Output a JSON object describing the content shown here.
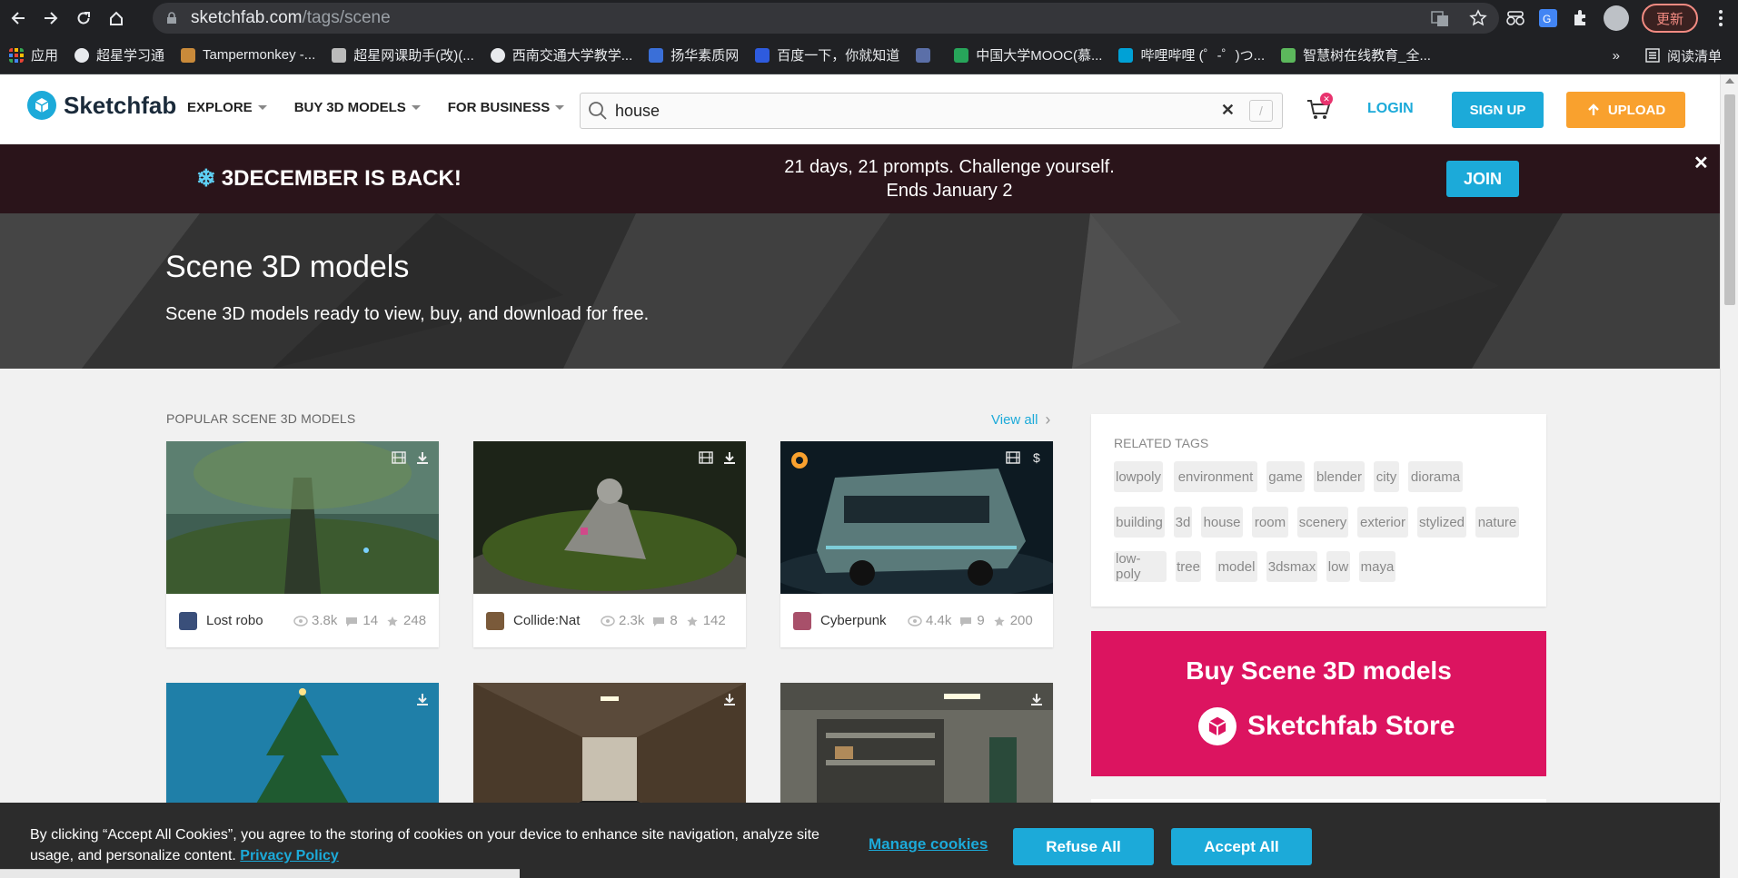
{
  "browser": {
    "url_host": "sketchfab.com",
    "url_path": "/tags/scene",
    "update_label": "更新",
    "bookmarks": [
      {
        "label": "应用",
        "color": "#ea4335"
      },
      {
        "label": "超星学习通",
        "color": "#ffffff"
      },
      {
        "label": "Tampermonkey -...",
        "color": "#c98a3a"
      },
      {
        "label": "超星网课助手(改)(...",
        "color": "#bbbbbb"
      },
      {
        "label": "西南交通大学教学...",
        "color": "#ffffff"
      },
      {
        "label": "扬华素质网",
        "color": "#3a6fd8"
      },
      {
        "label": "百度一下，你就知道",
        "color": "#2e5bde"
      },
      {
        "label": "",
        "color": "#5b6fa8"
      },
      {
        "label": "中国大学MOOC(慕...",
        "color": "#27a55a"
      },
      {
        "label": "哔哩哔哩 (゜-゜)つ...",
        "color": "#00a1d6"
      },
      {
        "label": "智慧树在线教育_全...",
        "color": "#5cb85c"
      }
    ],
    "more_label": "»",
    "reading_list_label": "阅读清单"
  },
  "header": {
    "logo_text": "Sketchfab",
    "nav": [
      "EXPLORE",
      "BUY 3D MODELS",
      "FOR BUSINESS"
    ],
    "search_value": "house",
    "search_slash": "/",
    "cart_badge": "✕",
    "login": "LOGIN",
    "signup": "SIGN UP",
    "upload": "UPLOAD"
  },
  "banner": {
    "title": "3DECEMBER IS BACK!",
    "line1": "21 days, 21 prompts. Challenge yourself.",
    "line2": "Ends January 2",
    "join": "JOIN",
    "close": "✕"
  },
  "hero": {
    "title": "Scene 3D models",
    "subtitle": "Scene 3D models ready to view, buy, and download for free."
  },
  "popular": {
    "title": "POPULAR SCENE 3D MODELS",
    "view_all": "View all",
    "cards": [
      {
        "name": "Lost robo",
        "views": "3.8k",
        "comments": "14",
        "likes": "248",
        "avatar": "#3a4f7a"
      },
      {
        "name": "Collide:Nat",
        "views": "2.3k",
        "comments": "8",
        "likes": "142",
        "avatar": "#7a5a3a"
      },
      {
        "name": "Cyberpunk",
        "views": "4.4k",
        "comments": "9",
        "likes": "200",
        "avatar": "#a8506a"
      }
    ]
  },
  "related": {
    "title": "RELATED TAGS",
    "tags": [
      "lowpoly",
      "environment",
      "game",
      "blender",
      "city",
      "diorama",
      "building",
      "3d",
      "house",
      "room",
      "scenery",
      "exterior",
      "stylized",
      "nature",
      "low-poly",
      "tree",
      "model",
      "3dsmax",
      "low",
      "maya"
    ]
  },
  "store": {
    "line1": "Buy Scene 3D models",
    "line2": "Sketchfab Store"
  },
  "cookie": {
    "text": "By clicking “Accept All Cookies”, you agree to the storing of cookies on your device to enhance site navigation, analyze site usage, and personalize content.",
    "privacy": "Privacy Policy",
    "manage": "Manage cookies",
    "refuse": "Refuse All",
    "accept": "Accept All"
  },
  "colors": {
    "accent": "#1caad9",
    "upload": "#f9a12e",
    "banner_bg": "#2a141a",
    "store_bg": "#dc1460"
  }
}
